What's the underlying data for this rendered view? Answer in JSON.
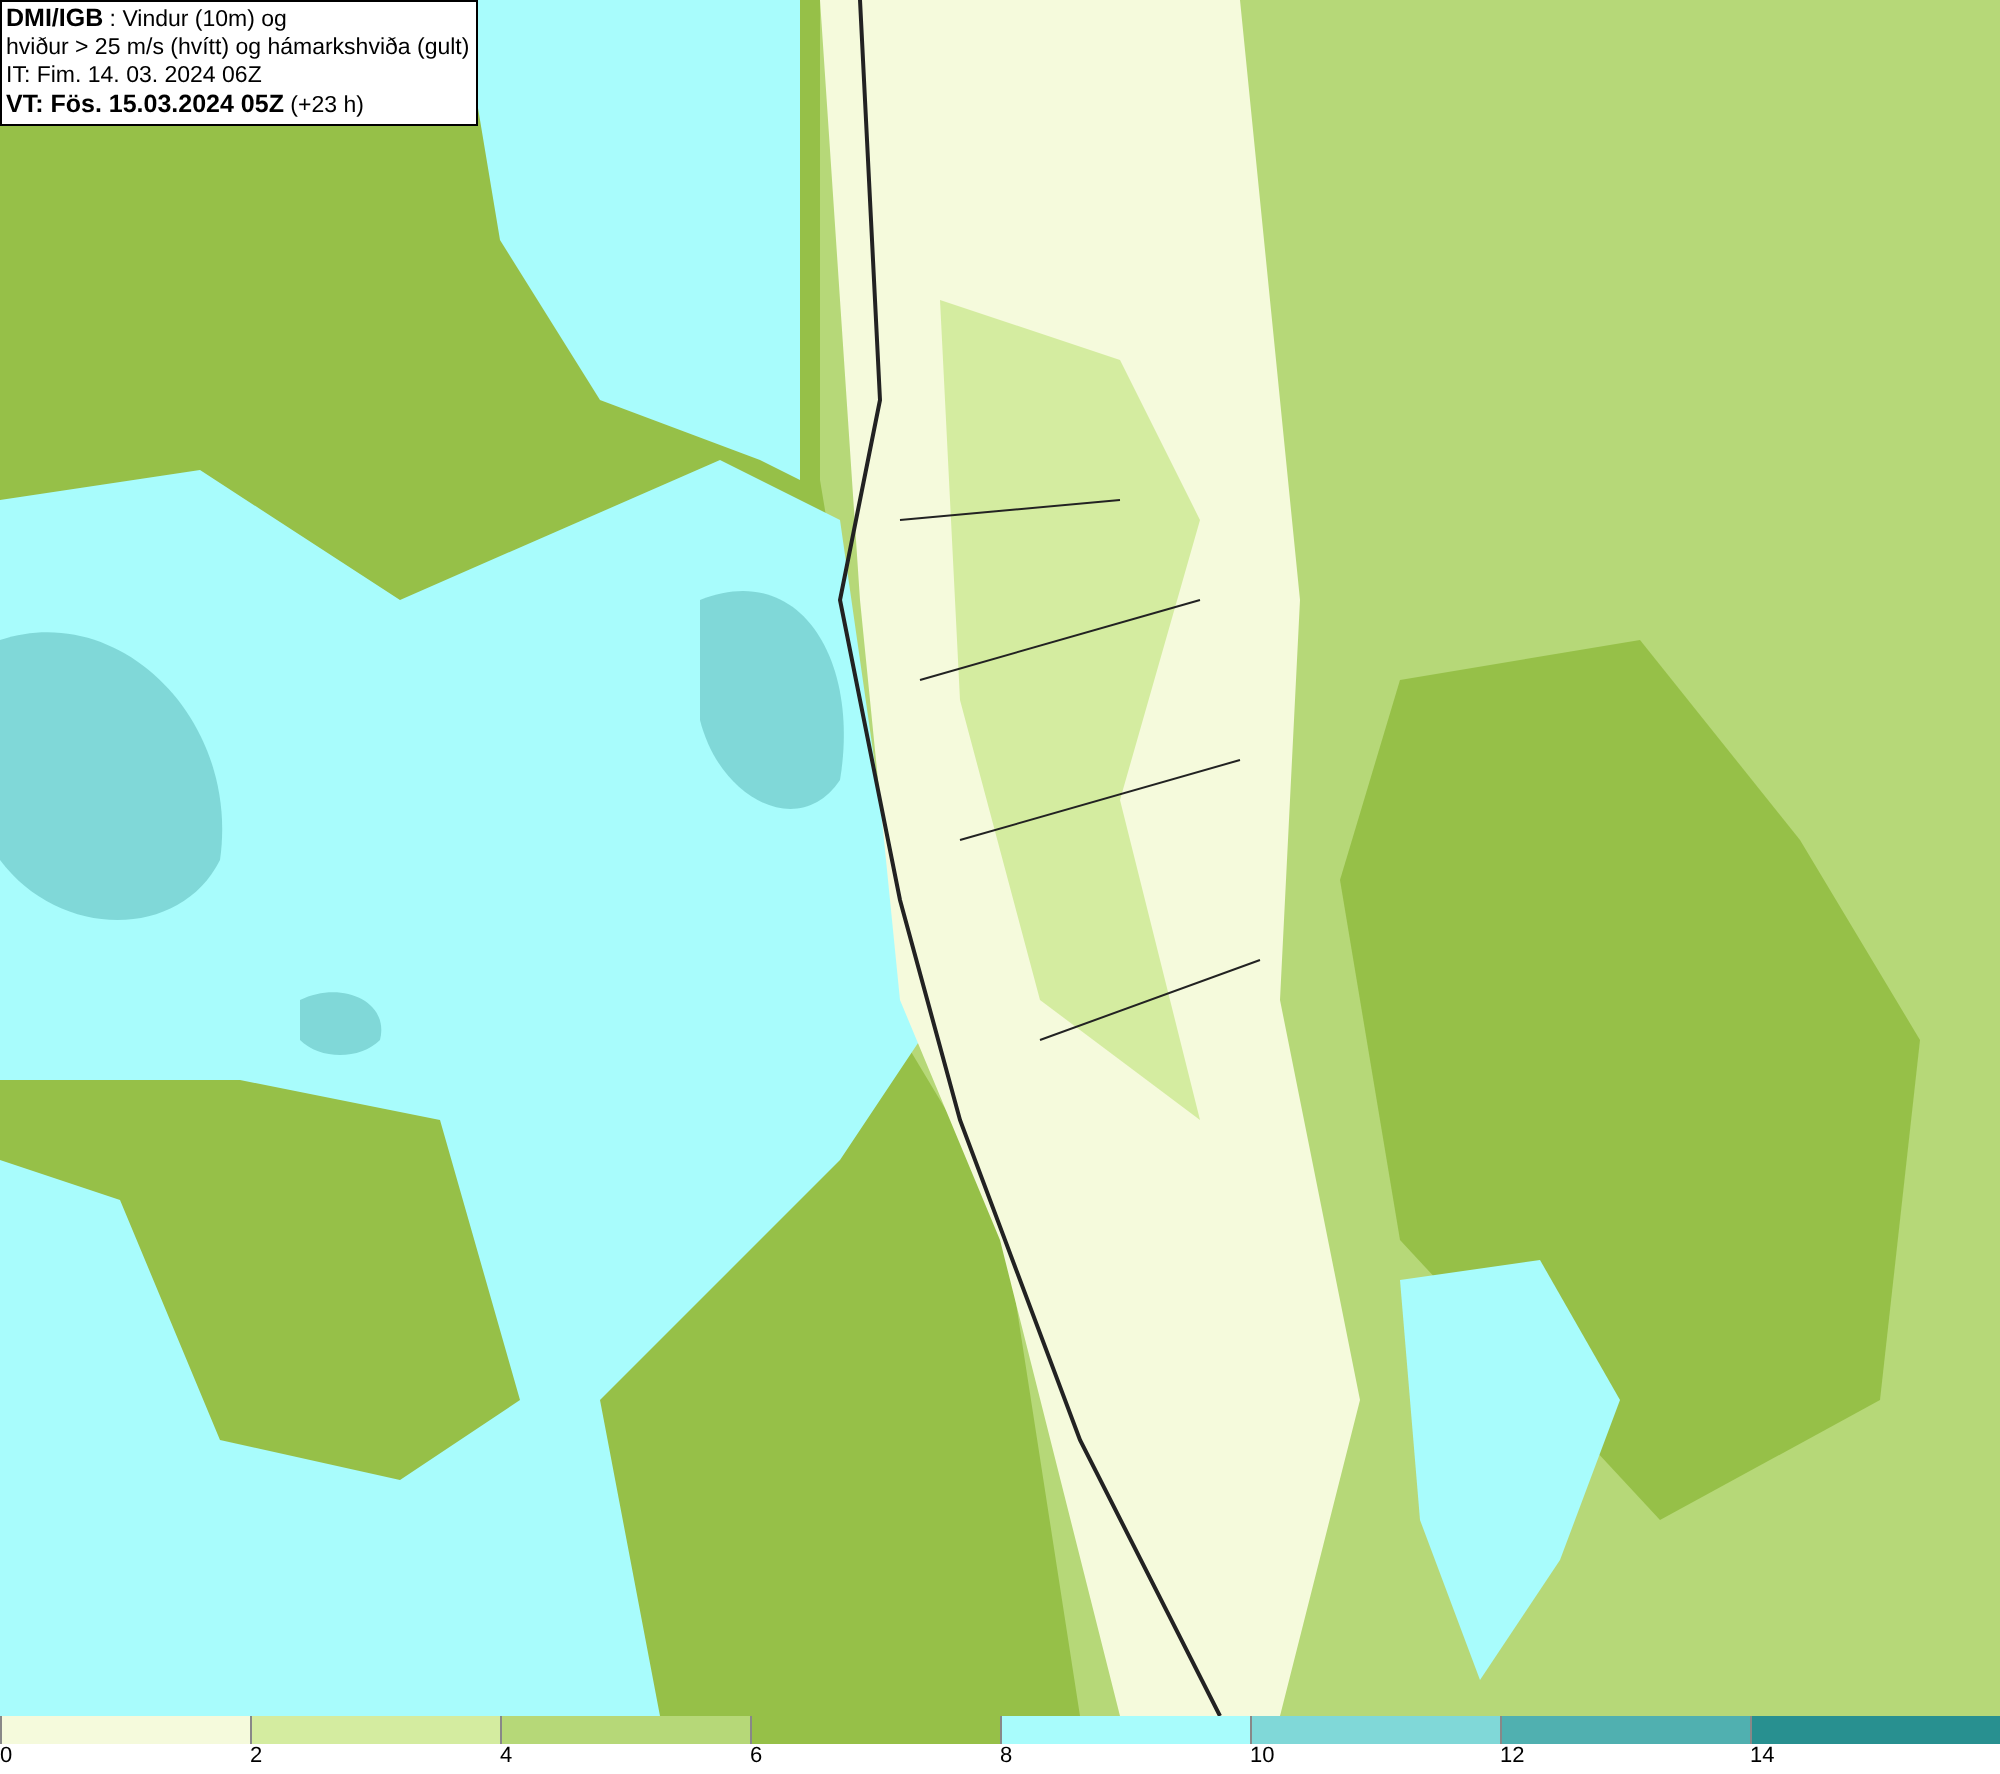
{
  "info_box": {
    "lines": [
      "**DMI/IGB** : Vindur (10m) og",
      "hviður > 25 m/s (hvítt) og hámarkshviða (gult)",
      "IT: Fim. 14. 03. 2024 06Z",
      "**VT: Fös. 15.03.2024 05Z** (+23 h)"
    ]
  },
  "legend": {
    "segments": [
      {
        "color": "#f5fadc"
      },
      {
        "color": "#d4eca0"
      },
      {
        "color": "#b6d878"
      },
      {
        "color": "#96c048"
      },
      {
        "color": "#a8fcfc"
      },
      {
        "color": "#80d8d8"
      },
      {
        "color": "#50b0b0"
      },
      {
        "color": "#289090"
      }
    ],
    "ticks": [
      "0",
      "2",
      "4",
      "6",
      "8",
      "10",
      "12",
      "14"
    ]
  }
}
